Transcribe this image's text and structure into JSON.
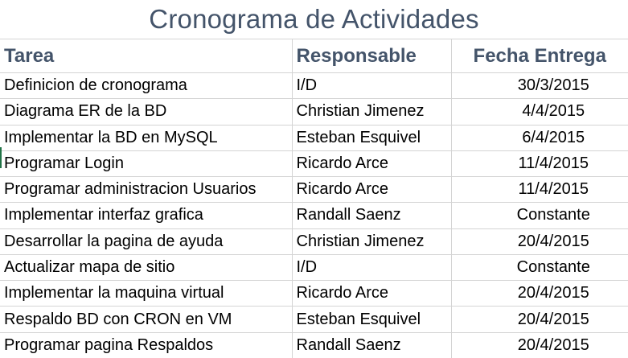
{
  "title": "Cronograma de Actividades",
  "headers": [
    "Tarea",
    "Responsable",
    "Fecha Entrega"
  ],
  "rows": [
    [
      "Definicion de cronograma",
      "I/D",
      "30/3/2015"
    ],
    [
      "Diagrama ER de la BD",
      "Christian Jimenez",
      "4/4/2015"
    ],
    [
      "Implementar la BD en MySQL",
      "Esteban Esquivel",
      "6/4/2015"
    ],
    [
      "Programar Login",
      "Ricardo Arce",
      "11/4/2015"
    ],
    [
      "Programar administracion Usuarios",
      "Ricardo Arce",
      "11/4/2015"
    ],
    [
      "Implementar interfaz grafica",
      "Randall Saenz",
      "Constante"
    ],
    [
      "Desarrollar la pagina de ayuda",
      "Christian Jimenez",
      "20/4/2015"
    ],
    [
      "Actualizar mapa de sitio",
      "I/D",
      "Constante"
    ],
    [
      "Implementar la maquina virtual",
      "Ricardo Arce",
      "20/4/2015"
    ],
    [
      "Respaldo BD con CRON en VM",
      "Esteban Esquivel",
      "20/4/2015"
    ],
    [
      "Programar pagina Respaldos",
      "Randall Saenz",
      "20/4/2015"
    ]
  ],
  "colors": {
    "title": "#44546a",
    "gridline": "#d4d4d4",
    "selection": "#217346"
  }
}
